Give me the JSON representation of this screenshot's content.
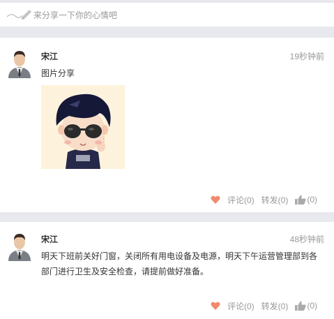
{
  "compose": {
    "placeholder": "来分享一下你的心情吧"
  },
  "posts": [
    {
      "author": "宋江",
      "time": "19秒钟前",
      "text": "图片分享",
      "comment_label": "评论(0)",
      "repost_label": "转发(0)",
      "like_count": "(0)"
    },
    {
      "author": "宋江",
      "time": "48秒钟前",
      "text": "明天下班前关好门窗，关闭所有用电设备及电源，明天下午运营管理部到各部门进行卫生及安全检查，请提前做好准备。",
      "comment_label": "评论(0)",
      "repost_label": "转发(0)",
      "like_count": "(0)"
    }
  ],
  "colors": {
    "heart": "#f08a6e",
    "gap": "#e8e9ee",
    "muted": "#999999"
  },
  "icons": [
    "pen-icon",
    "avatar-icon",
    "heart-icon",
    "thumbs-up-icon"
  ]
}
